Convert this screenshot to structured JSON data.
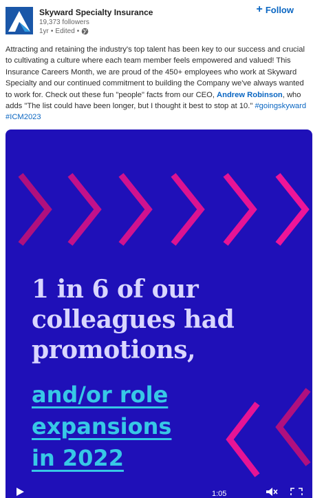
{
  "post": {
    "company_name": "Skyward Specialty Insurance",
    "followers": "19,373 followers",
    "age": "1yr",
    "edited": "Edited",
    "follow_label": "Follow",
    "text_1": "Attracting and retaining the industry's top talent has been key to our success and crucial to cultivating a culture where each team member feels empowered and valued! This Insurance Careers Month, we are proud of the 450+ employees who work at Skyward Specialty and our continued commitment to building the Company we've always wanted to work for. Check out these fun \"people\" facts from our CEO, ",
    "mention": "Andrew Robinson",
    "text_2": ", who adds \"The list could have been longer, but I thought it best to stop at 10.\" ",
    "hashtag_1": "#goingskyward",
    "hashtag_2": "#ICM2023"
  },
  "video": {
    "headline_lines": [
      "1 in 6 of our",
      "colleagues had",
      "promotions,"
    ],
    "sub_lines": [
      "and/or role",
      "expansions",
      "in 2022"
    ],
    "time": "1:05",
    "colors": {
      "background": "#1f10b8",
      "chevron": "#e0118c",
      "headline": "#d9d6ff",
      "accent": "#37c8e6"
    }
  },
  "icons": [
    "company-logo-icon",
    "globe-icon",
    "plus-icon",
    "play-icon",
    "mute-icon",
    "fullscreen-icon"
  ]
}
